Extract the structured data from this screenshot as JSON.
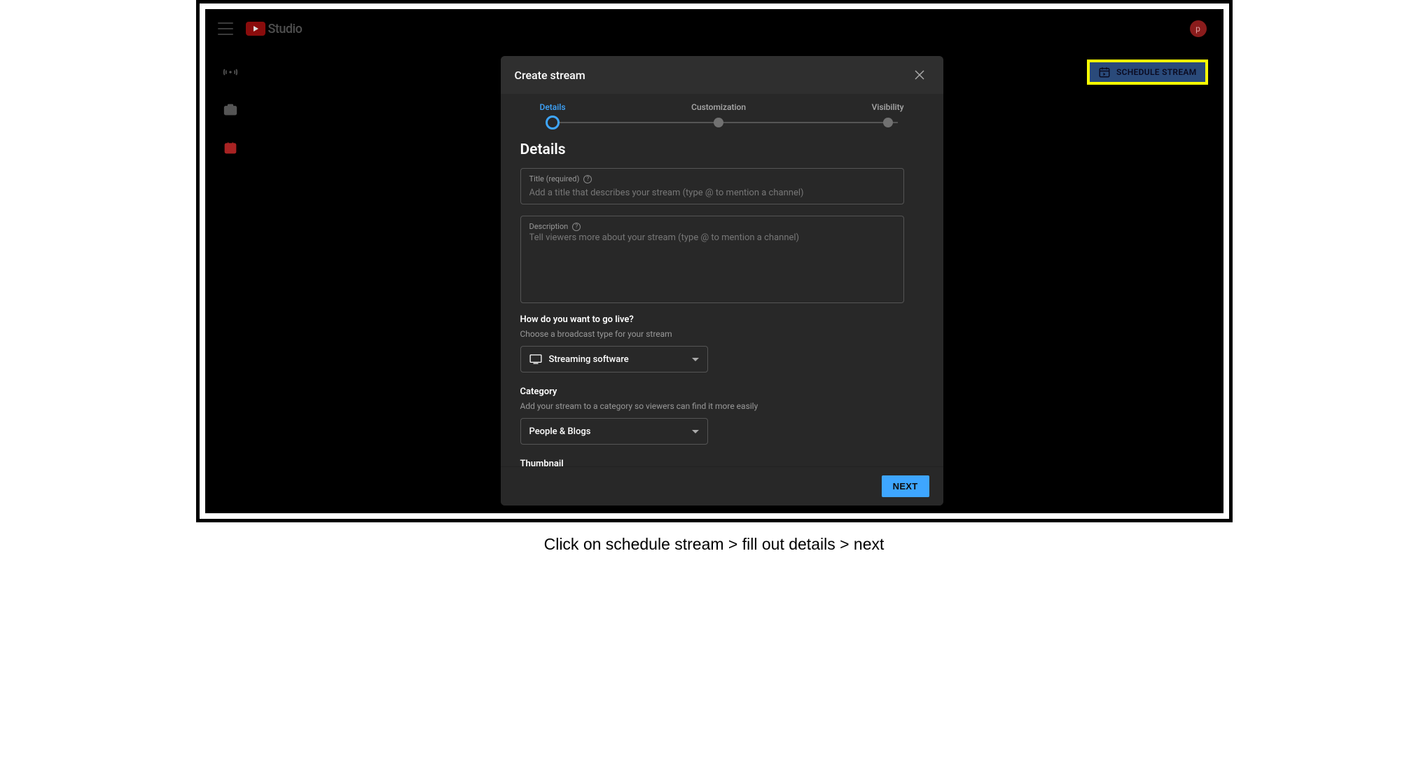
{
  "header": {
    "logo_text": "Studio",
    "avatar_letter": "p"
  },
  "schedule_button_label": "SCHEDULE STREAM",
  "dialog": {
    "title": "Create stream",
    "steps": {
      "details": "Details",
      "customization": "Customization",
      "visibility": "Visibility"
    },
    "sections": {
      "details_head": "Details",
      "title_field": {
        "label": "Title (required)",
        "placeholder": "Add a title that describes your stream (type @ to mention a channel)",
        "value": ""
      },
      "desc_field": {
        "label": "Description",
        "placeholder": "Tell viewers more about your stream (type @ to mention a channel)",
        "value": ""
      },
      "golive_head": "How do you want to go live?",
      "golive_desc": "Choose a broadcast type for your stream",
      "broadcast_selected": "Streaming software",
      "category_head": "Category",
      "category_desc": "Add your stream to a category so viewers can find it more easily",
      "category_selected": "People & Blogs",
      "thumbnail_head": "Thumbnail"
    },
    "next_label": "NEXT"
  },
  "caption": "Click on schedule stream > fill out details > next"
}
